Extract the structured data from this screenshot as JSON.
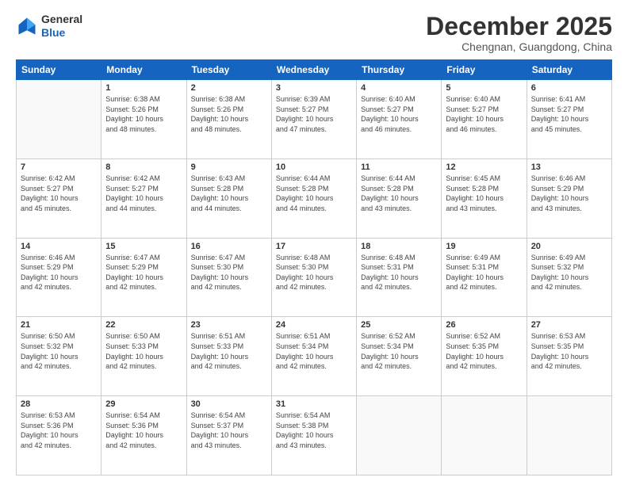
{
  "logo": {
    "general": "General",
    "blue": "Blue"
  },
  "header": {
    "month": "December 2025",
    "location": "Chengnan, Guangdong, China"
  },
  "weekdays": [
    "Sunday",
    "Monday",
    "Tuesday",
    "Wednesday",
    "Thursday",
    "Friday",
    "Saturday"
  ],
  "weeks": [
    [
      {
        "day": "",
        "info": ""
      },
      {
        "day": "1",
        "info": "Sunrise: 6:38 AM\nSunset: 5:26 PM\nDaylight: 10 hours\nand 48 minutes."
      },
      {
        "day": "2",
        "info": "Sunrise: 6:38 AM\nSunset: 5:26 PM\nDaylight: 10 hours\nand 48 minutes."
      },
      {
        "day": "3",
        "info": "Sunrise: 6:39 AM\nSunset: 5:27 PM\nDaylight: 10 hours\nand 47 minutes."
      },
      {
        "day": "4",
        "info": "Sunrise: 6:40 AM\nSunset: 5:27 PM\nDaylight: 10 hours\nand 46 minutes."
      },
      {
        "day": "5",
        "info": "Sunrise: 6:40 AM\nSunset: 5:27 PM\nDaylight: 10 hours\nand 46 minutes."
      },
      {
        "day": "6",
        "info": "Sunrise: 6:41 AM\nSunset: 5:27 PM\nDaylight: 10 hours\nand 45 minutes."
      }
    ],
    [
      {
        "day": "7",
        "info": "Sunrise: 6:42 AM\nSunset: 5:27 PM\nDaylight: 10 hours\nand 45 minutes."
      },
      {
        "day": "8",
        "info": "Sunrise: 6:42 AM\nSunset: 5:27 PM\nDaylight: 10 hours\nand 44 minutes."
      },
      {
        "day": "9",
        "info": "Sunrise: 6:43 AM\nSunset: 5:28 PM\nDaylight: 10 hours\nand 44 minutes."
      },
      {
        "day": "10",
        "info": "Sunrise: 6:44 AM\nSunset: 5:28 PM\nDaylight: 10 hours\nand 44 minutes."
      },
      {
        "day": "11",
        "info": "Sunrise: 6:44 AM\nSunset: 5:28 PM\nDaylight: 10 hours\nand 43 minutes."
      },
      {
        "day": "12",
        "info": "Sunrise: 6:45 AM\nSunset: 5:28 PM\nDaylight: 10 hours\nand 43 minutes."
      },
      {
        "day": "13",
        "info": "Sunrise: 6:46 AM\nSunset: 5:29 PM\nDaylight: 10 hours\nand 43 minutes."
      }
    ],
    [
      {
        "day": "14",
        "info": "Sunrise: 6:46 AM\nSunset: 5:29 PM\nDaylight: 10 hours\nand 42 minutes."
      },
      {
        "day": "15",
        "info": "Sunrise: 6:47 AM\nSunset: 5:29 PM\nDaylight: 10 hours\nand 42 minutes."
      },
      {
        "day": "16",
        "info": "Sunrise: 6:47 AM\nSunset: 5:30 PM\nDaylight: 10 hours\nand 42 minutes."
      },
      {
        "day": "17",
        "info": "Sunrise: 6:48 AM\nSunset: 5:30 PM\nDaylight: 10 hours\nand 42 minutes."
      },
      {
        "day": "18",
        "info": "Sunrise: 6:48 AM\nSunset: 5:31 PM\nDaylight: 10 hours\nand 42 minutes."
      },
      {
        "day": "19",
        "info": "Sunrise: 6:49 AM\nSunset: 5:31 PM\nDaylight: 10 hours\nand 42 minutes."
      },
      {
        "day": "20",
        "info": "Sunrise: 6:49 AM\nSunset: 5:32 PM\nDaylight: 10 hours\nand 42 minutes."
      }
    ],
    [
      {
        "day": "21",
        "info": "Sunrise: 6:50 AM\nSunset: 5:32 PM\nDaylight: 10 hours\nand 42 minutes."
      },
      {
        "day": "22",
        "info": "Sunrise: 6:50 AM\nSunset: 5:33 PM\nDaylight: 10 hours\nand 42 minutes."
      },
      {
        "day": "23",
        "info": "Sunrise: 6:51 AM\nSunset: 5:33 PM\nDaylight: 10 hours\nand 42 minutes."
      },
      {
        "day": "24",
        "info": "Sunrise: 6:51 AM\nSunset: 5:34 PM\nDaylight: 10 hours\nand 42 minutes."
      },
      {
        "day": "25",
        "info": "Sunrise: 6:52 AM\nSunset: 5:34 PM\nDaylight: 10 hours\nand 42 minutes."
      },
      {
        "day": "26",
        "info": "Sunrise: 6:52 AM\nSunset: 5:35 PM\nDaylight: 10 hours\nand 42 minutes."
      },
      {
        "day": "27",
        "info": "Sunrise: 6:53 AM\nSunset: 5:35 PM\nDaylight: 10 hours\nand 42 minutes."
      }
    ],
    [
      {
        "day": "28",
        "info": "Sunrise: 6:53 AM\nSunset: 5:36 PM\nDaylight: 10 hours\nand 42 minutes."
      },
      {
        "day": "29",
        "info": "Sunrise: 6:54 AM\nSunset: 5:36 PM\nDaylight: 10 hours\nand 42 minutes."
      },
      {
        "day": "30",
        "info": "Sunrise: 6:54 AM\nSunset: 5:37 PM\nDaylight: 10 hours\nand 43 minutes."
      },
      {
        "day": "31",
        "info": "Sunrise: 6:54 AM\nSunset: 5:38 PM\nDaylight: 10 hours\nand 43 minutes."
      },
      {
        "day": "",
        "info": ""
      },
      {
        "day": "",
        "info": ""
      },
      {
        "day": "",
        "info": ""
      }
    ]
  ]
}
